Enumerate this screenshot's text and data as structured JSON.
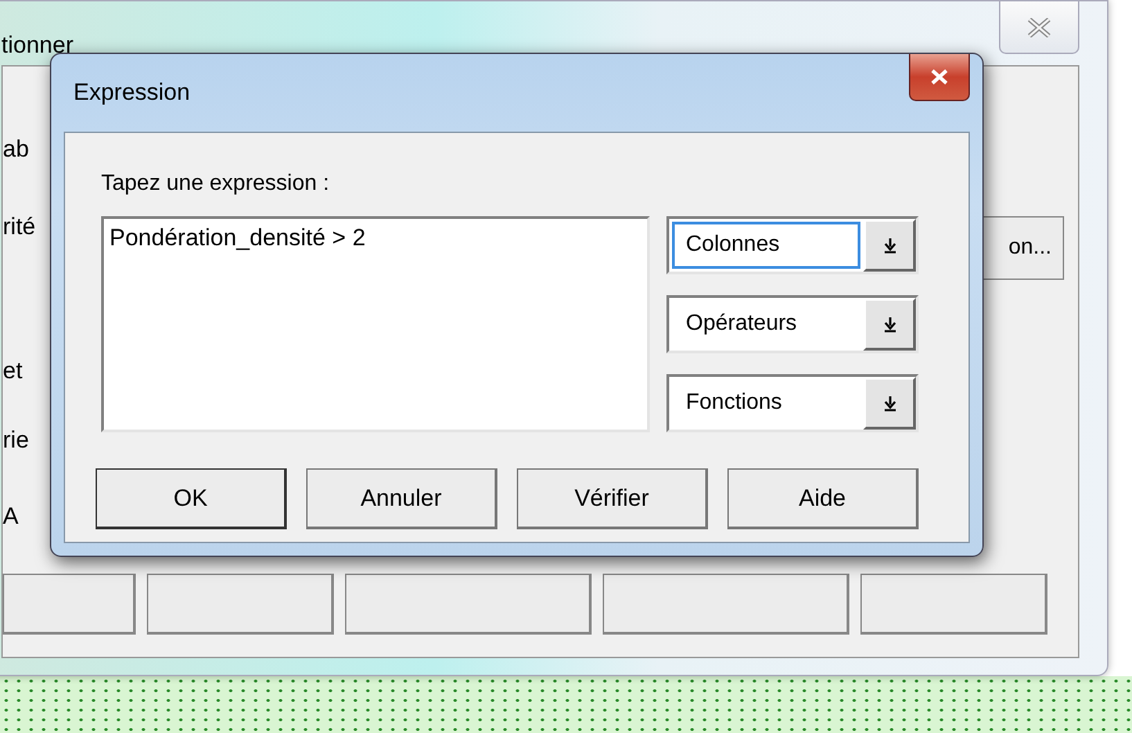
{
  "background_window": {
    "title": "tionner",
    "labels": [
      "ab",
      "rité",
      "et",
      "rie",
      "A"
    ],
    "side_button": "on..."
  },
  "dialog": {
    "title": "Expression",
    "prompt": "Tapez une expression :",
    "expression": "Pondération_densité > 2",
    "dropdowns": [
      {
        "value": "Colonnes",
        "focused": true
      },
      {
        "value": "Opérateurs",
        "focused": false
      },
      {
        "value": "Fonctions",
        "focused": false
      }
    ],
    "buttons": [
      "OK",
      "Annuler",
      "Vérifier",
      "Aide"
    ]
  }
}
